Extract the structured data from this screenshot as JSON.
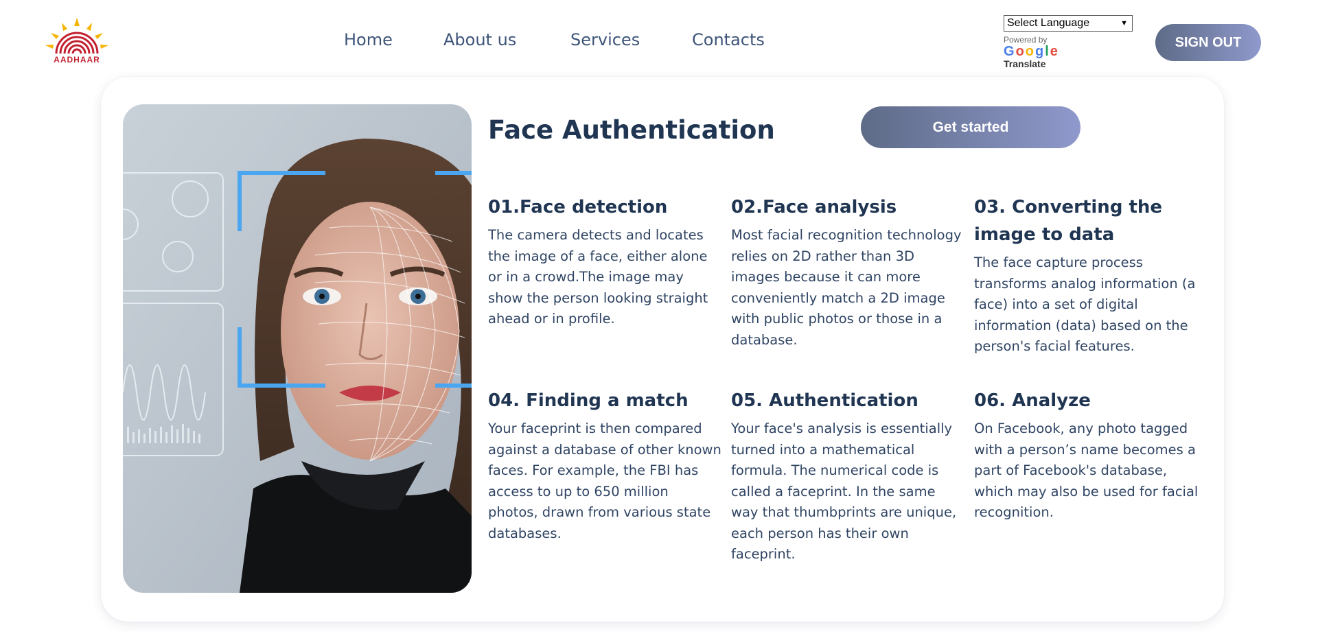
{
  "header": {
    "logo_text": "AADHAAR",
    "nav": [
      {
        "label": "Home"
      },
      {
        "label": "About us"
      },
      {
        "label": "Services"
      },
      {
        "label": "Contacts"
      }
    ],
    "translate": {
      "select_value": "Select Language",
      "powered_by": "Powered by",
      "google": "Google",
      "translate_label": "Translate"
    },
    "signout_label": "SIGN OUT"
  },
  "main": {
    "title": "Face Authentication",
    "cta_label": "Get started",
    "steps": [
      {
        "title": "01.Face detection",
        "text": "The camera detects and locates the image of a face, either alone or in a crowd.The image may show the person looking straight ahead or in profile."
      },
      {
        "title": "02.Face analysis",
        "text": "Most facial recognition technology relies on 2D rather than 3D images because it can more conveniently match a 2D image with public photos or those in a database."
      },
      {
        "title": "03. Converting the image to data",
        "text": "The face capture process transforms analog information (a face) into a set of digital information (data) based on the person's facial features."
      },
      {
        "title": "04. Finding a match",
        "text": "Your faceprint is then compared against a database of other known faces. For example, the FBI has access to up to 650 million photos, drawn from various state databases."
      },
      {
        "title": "05. Authentication",
        "text": "Your face's analysis is essentially turned into a mathematical formula. The numerical code is called a faceprint. In the same way that thumbprints are unique, each person has their own faceprint."
      },
      {
        "title": "06. Analyze",
        "text": "On Facebook, any photo tagged with a person’s name becomes a part of Facebook's database, which may also be used for facial recognition."
      }
    ]
  },
  "colors": {
    "brand_text": "#1f3552",
    "button_gradient_start": "#5e6b87",
    "button_gradient_end": "#8f99cc",
    "logo_red": "#c3202f",
    "logo_sun": "#f4b400"
  }
}
